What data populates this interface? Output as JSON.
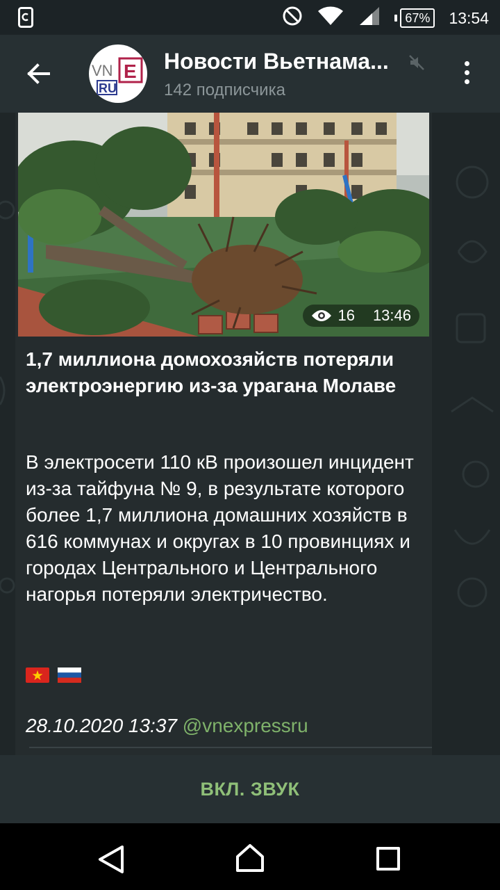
{
  "status_bar": {
    "time": "13:54",
    "battery": "67%"
  },
  "header": {
    "channel_name": "Новости Вьетнама...",
    "subscribers": "142 подписчика",
    "avatar": {
      "vn": "VN",
      "e": "E",
      "ru": "RU"
    }
  },
  "post": {
    "views": "16",
    "time": "13:46",
    "headline": "1,7 миллиона домохозяйств потеряли электроэнергию из-за урагана Молаве",
    "body": "В электросети 110 кВ произошел инцидент из-за тайфуна № 9, в результате которого более 1,7 миллиона домашних хозяйств в 616 коммунах и округах в 10 провинциях и городах Центрального и Центрального нагорья потеряли электричество.",
    "footer_date": "28.10.2020 13:37",
    "footer_handle": "@vnexpressru"
  },
  "sound_button": "ВКЛ. ЗВУК",
  "colors": {
    "accent": "#8fbf78",
    "header_bg": "#273033",
    "chat_bg": "#1f2628",
    "bubble_bg": "#252c2e"
  }
}
